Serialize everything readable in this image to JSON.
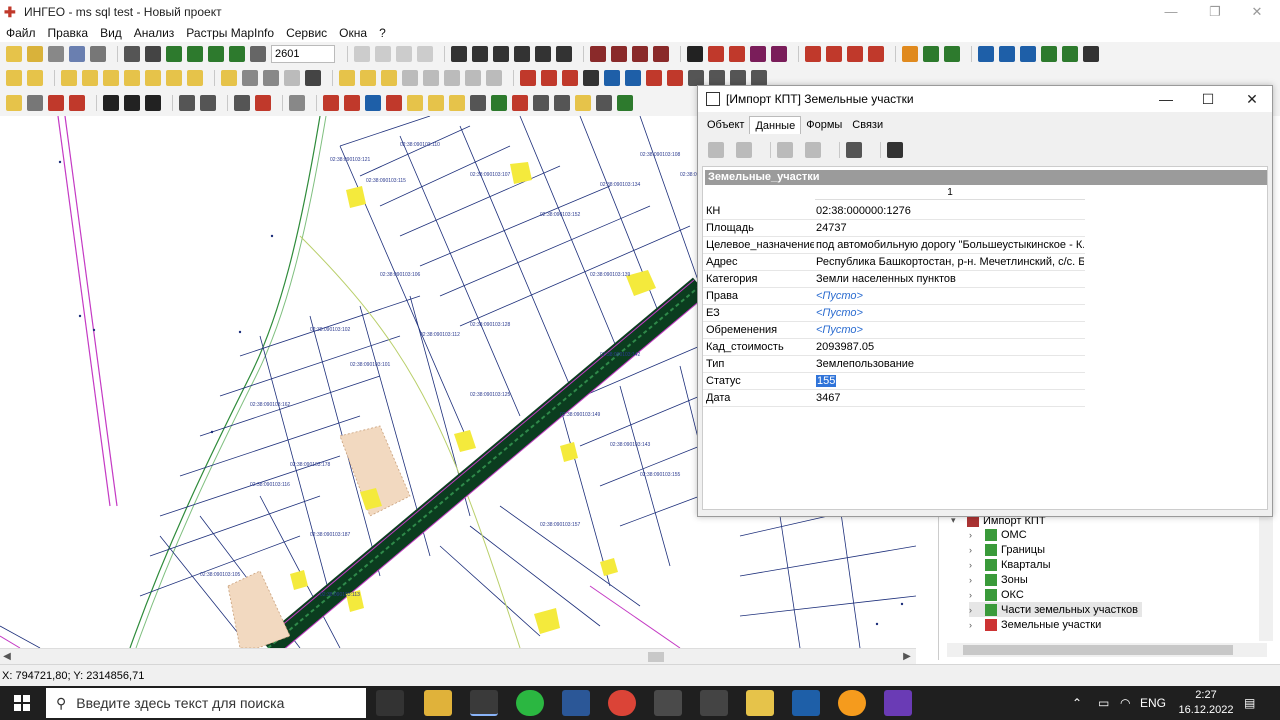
{
  "window": {
    "title": "ИНГЕО - ms sql test - Новый проект",
    "controls": [
      "—",
      "❐",
      "✕"
    ]
  },
  "menu": [
    "Файл",
    "Правка",
    "Вид",
    "Анализ",
    "Растры MapInfo",
    "Сервис",
    "Окна",
    "?"
  ],
  "toolbar": {
    "scale_value": "2601"
  },
  "map": {
    "parcel_labels": [
      "02:38:090103:121",
      "02:38:090103:115",
      "02:38:090103:110",
      "02:38:090103:107",
      "02:38:090103:152",
      "02:38:090103:134",
      "02:38:090103:108",
      "02:38:090103:106",
      "02:38:090103:102",
      "02:38:090103:101",
      "02:38:090103:112",
      "02:38:090103:128",
      "02:38:090103:139",
      "02:38:090103:149",
      "02:38:090103:143",
      "02:38:090103:155",
      "02:38:090103:162",
      "02:38:090103:178",
      "02:38:090103:187",
      "02:38:090103:113",
      "02:38:090103:105",
      "02:38:090103:157",
      "02:38:090103:142",
      "02:38:090103:136",
      "02:38:090103:125",
      "02:38:090103:116"
    ]
  },
  "statusbar": {
    "coords": "X: 794721,80; Y: 2314856,71"
  },
  "tree": {
    "root": "Импорт КПТ",
    "items": [
      "ОМС",
      "Границы",
      "Кварталы",
      "Зоны",
      "ОКС",
      "Части земельных участков",
      "Земельные участки"
    ]
  },
  "dialog": {
    "title": "[Импорт КПТ] Земельные участки",
    "tabs": [
      "Объект",
      "Данные",
      "Формы",
      "Связи"
    ],
    "active_tab": "Данные",
    "table_title": "Земельные_участки",
    "column_header": "1",
    "rows": [
      {
        "key": "КН",
        "value": "02:38:000000:1276"
      },
      {
        "key": "Площадь",
        "value": "24737"
      },
      {
        "key": "Целевое_назначение",
        "value": "под автомобильную дорогу \"Большеустыкинское - К..."
      },
      {
        "key": "Адрес",
        "value": "Республика Башкортостан, р-н. Мечетлинский, с/с. Б..."
      },
      {
        "key": "Категория",
        "value": "Земли населенных пунктов"
      },
      {
        "key": "Права",
        "value": "<Пусто>"
      },
      {
        "key": "ЕЗ",
        "value": "<Пусто>"
      },
      {
        "key": "Обременения",
        "value": "<Пусто>"
      },
      {
        "key": "Кад_стоимость",
        "value": "2093987.05"
      },
      {
        "key": "Тип",
        "value": "Землепользование"
      },
      {
        "key": "Статус",
        "value": "155"
      },
      {
        "key": "Дата",
        "value": "3467"
      }
    ]
  },
  "taskbar": {
    "search_placeholder": "Введите здесь текст для поиска",
    "language": "ENG",
    "time": "2:27",
    "date": "16.12.2022"
  },
  "colors": {
    "road_dark": "#0b3d1f",
    "parcel_line": "#1c2e7a",
    "highlight_yellow": "#f4ea3c",
    "boundary_magenta": "#c43ac4",
    "selection_blue": "#3074d9"
  }
}
